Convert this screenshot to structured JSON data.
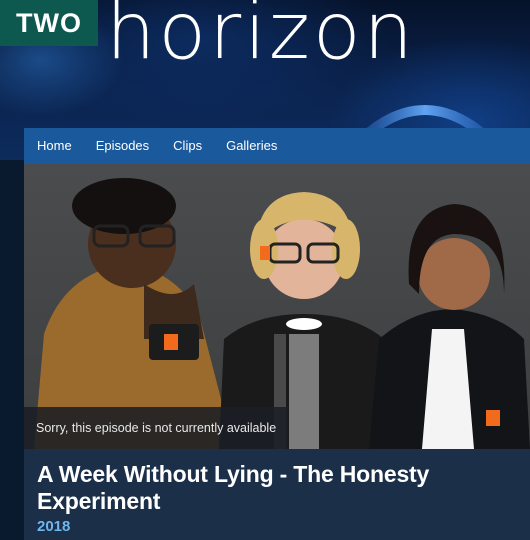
{
  "header": {
    "channel_badge": "TWO",
    "brand_title": "horizon"
  },
  "nav": {
    "items": [
      {
        "label": "Home"
      },
      {
        "label": "Episodes"
      },
      {
        "label": "Clips"
      },
      {
        "label": "Galleries"
      }
    ]
  },
  "hero": {
    "unavailable_message": "Sorry, this episode is not currently available"
  },
  "episode": {
    "title": "A Week Without Lying - The Honesty Experiment",
    "year": "2018"
  },
  "colors": {
    "badge_bg": "#0d5950",
    "nav_bg": "#1a5a9c",
    "info_bg": "#1b2f49",
    "year_text": "#6fb6f0",
    "wristband_accent": "#f26a1b"
  }
}
